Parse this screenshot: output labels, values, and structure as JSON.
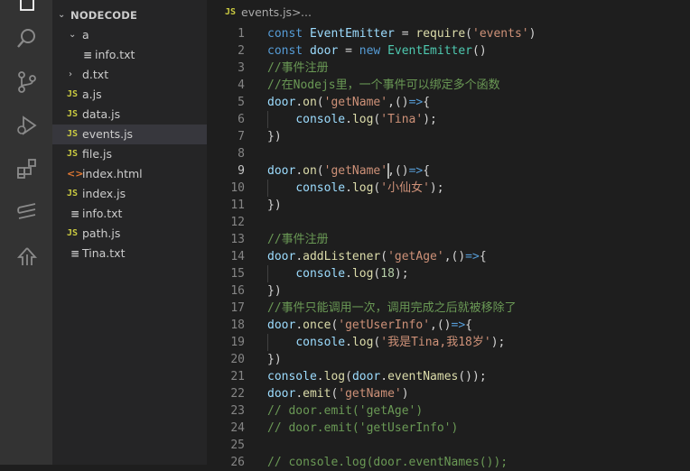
{
  "explorer": {
    "root": "NODECODE",
    "items": [
      {
        "label": "a",
        "type": "folder",
        "depth": 1,
        "expanded": true
      },
      {
        "label": "info.txt",
        "type": "txt",
        "depth": 2
      },
      {
        "label": "d.txt",
        "type": "folder",
        "depth": 1,
        "expanded": false
      },
      {
        "label": "a.js",
        "type": "js",
        "depth": 1
      },
      {
        "label": "data.js",
        "type": "js",
        "depth": 1
      },
      {
        "label": "events.js",
        "type": "js",
        "depth": 1,
        "selected": true
      },
      {
        "label": "file.js",
        "type": "js",
        "depth": 1
      },
      {
        "label": "index.html",
        "type": "html",
        "depth": 1
      },
      {
        "label": "index.js",
        "type": "js",
        "depth": 1
      },
      {
        "label": "info.txt",
        "type": "txt",
        "depth": 1
      },
      {
        "label": "path.js",
        "type": "js",
        "depth": 1
      },
      {
        "label": "Tina.txt",
        "type": "txt",
        "depth": 1
      }
    ],
    "icons": {
      "js": "JS",
      "txt": "≡",
      "html": "<>"
    }
  },
  "breadcrumb": {
    "icon": "JS",
    "file": "events.js",
    "separator": ">",
    "rest": "..."
  },
  "editor": {
    "active_line": 9,
    "cursor": {
      "line": 9,
      "col": 17
    },
    "lines": [
      [
        [
          "kw",
          "const "
        ],
        [
          "var",
          "EventEmitter"
        ],
        [
          "p",
          " = "
        ],
        [
          "fn",
          "require"
        ],
        [
          "p",
          "("
        ],
        [
          "str",
          "'events'"
        ],
        [
          "p",
          ")"
        ]
      ],
      [
        [
          "kw",
          "const "
        ],
        [
          "var",
          "door"
        ],
        [
          "p",
          " = "
        ],
        [
          "kw",
          "new "
        ],
        [
          "cls",
          "EventEmitter"
        ],
        [
          "p",
          "()"
        ]
      ],
      [
        [
          "cmt",
          "//事件注册"
        ]
      ],
      [
        [
          "cmt",
          "//在Nodejs里，一个事件可以绑定多个函数"
        ]
      ],
      [
        [
          "var",
          "door"
        ],
        [
          "p",
          "."
        ],
        [
          "fn",
          "on"
        ],
        [
          "p",
          "("
        ],
        [
          "str",
          "'getName'"
        ],
        [
          "p",
          ",()"
        ],
        [
          "kw",
          "=>"
        ],
        [
          "p",
          "{"
        ]
      ],
      [
        [
          "p",
          "    "
        ],
        [
          "var",
          "console"
        ],
        [
          "p",
          "."
        ],
        [
          "fn",
          "log"
        ],
        [
          "p",
          "("
        ],
        [
          "str",
          "'Tina'"
        ],
        [
          "p",
          ");"
        ]
      ],
      [
        [
          "p",
          "})"
        ]
      ],
      [],
      [
        [
          "var",
          "door"
        ],
        [
          "p",
          "."
        ],
        [
          "fn",
          "on"
        ],
        [
          "p",
          "("
        ],
        [
          "str",
          "'getName'"
        ],
        [
          "p",
          ",()"
        ],
        [
          "kw",
          "=>"
        ],
        [
          "p",
          "{"
        ]
      ],
      [
        [
          "p",
          "    "
        ],
        [
          "var",
          "console"
        ],
        [
          "p",
          "."
        ],
        [
          "fn",
          "log"
        ],
        [
          "p",
          "("
        ],
        [
          "str",
          "'小仙女'"
        ],
        [
          "p",
          ");"
        ]
      ],
      [
        [
          "p",
          "})"
        ]
      ],
      [],
      [
        [
          "cmt",
          "//事件注册"
        ]
      ],
      [
        [
          "var",
          "door"
        ],
        [
          "p",
          "."
        ],
        [
          "fn",
          "addListener"
        ],
        [
          "p",
          "("
        ],
        [
          "str",
          "'getAge'"
        ],
        [
          "p",
          ",()"
        ],
        [
          "kw",
          "=>"
        ],
        [
          "p",
          "{"
        ]
      ],
      [
        [
          "p",
          "    "
        ],
        [
          "var",
          "console"
        ],
        [
          "p",
          "."
        ],
        [
          "fn",
          "log"
        ],
        [
          "p",
          "("
        ],
        [
          "num",
          "18"
        ],
        [
          "p",
          ");"
        ]
      ],
      [
        [
          "p",
          "})"
        ]
      ],
      [
        [
          "cmt",
          "//事件只能调用一次，调用完成之后就被移除了"
        ]
      ],
      [
        [
          "var",
          "door"
        ],
        [
          "p",
          "."
        ],
        [
          "fn",
          "once"
        ],
        [
          "p",
          "("
        ],
        [
          "str",
          "'getUserInfo'"
        ],
        [
          "p",
          ",()"
        ],
        [
          "kw",
          "=>"
        ],
        [
          "p",
          "{"
        ]
      ],
      [
        [
          "p",
          "    "
        ],
        [
          "var",
          "console"
        ],
        [
          "p",
          "."
        ],
        [
          "fn",
          "log"
        ],
        [
          "p",
          "("
        ],
        [
          "str",
          "'我是Tina,我18岁'"
        ],
        [
          "p",
          ");"
        ]
      ],
      [
        [
          "p",
          "})"
        ]
      ],
      [
        [
          "var",
          "console"
        ],
        [
          "p",
          "."
        ],
        [
          "fn",
          "log"
        ],
        [
          "p",
          "("
        ],
        [
          "var",
          "door"
        ],
        [
          "p",
          "."
        ],
        [
          "fn",
          "eventNames"
        ],
        [
          "p",
          "());"
        ]
      ],
      [
        [
          "var",
          "door"
        ],
        [
          "p",
          "."
        ],
        [
          "fn",
          "emit"
        ],
        [
          "p",
          "("
        ],
        [
          "str",
          "'getName'"
        ],
        [
          "p",
          ")"
        ]
      ],
      [
        [
          "cmt",
          "// door.emit('getAge')"
        ]
      ],
      [
        [
          "cmt",
          "// door.emit('getUserInfo')"
        ]
      ],
      [],
      [
        [
          "cmt",
          "// console.log(door.eventNames());"
        ]
      ]
    ]
  },
  "overlay": {
    "cursor_glyph": "I"
  },
  "colors": {
    "activity_bar": "#333333",
    "sidebar": "#252526",
    "editor_bg": "#1e1e1e",
    "selected_row": "#37373d",
    "record_dot": "#d42a2a"
  }
}
